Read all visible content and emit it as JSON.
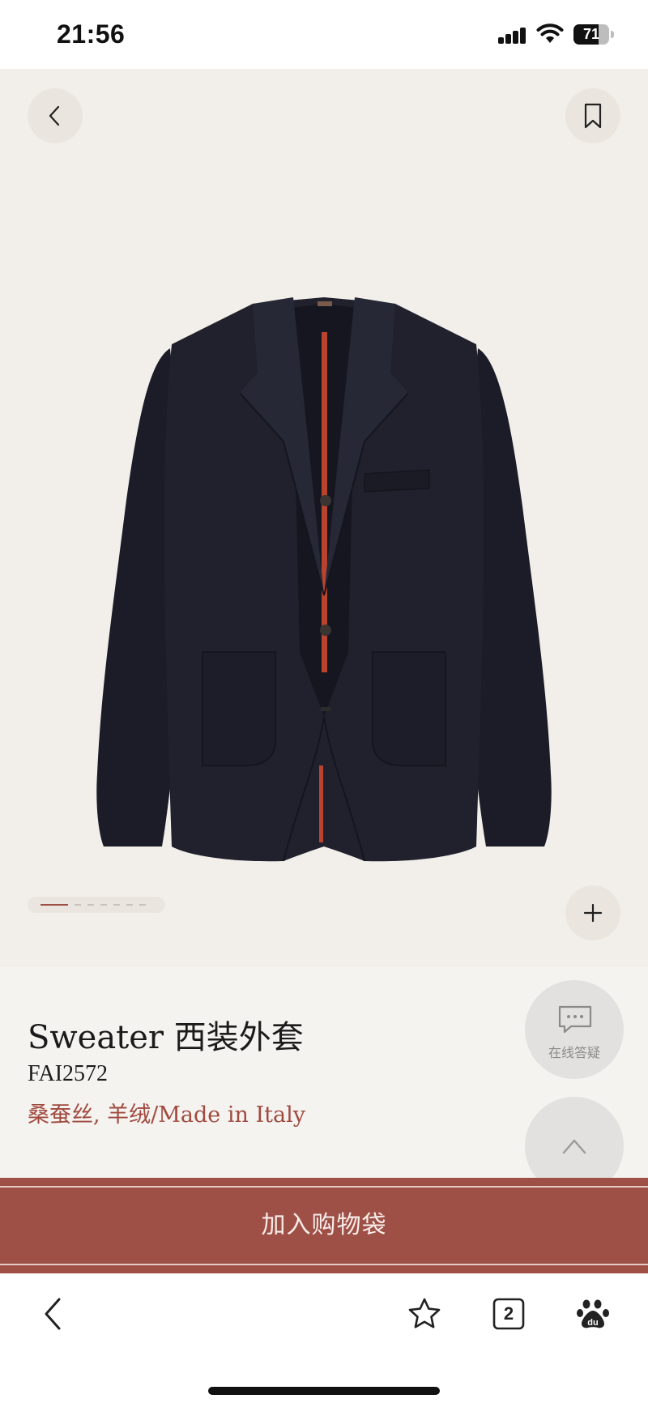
{
  "status_bar": {
    "time": "21:56",
    "battery_level": "71",
    "battery_fraction": 0.71
  },
  "product": {
    "title": "Sweater 西装外套",
    "code": "FAI2572",
    "material": "桑蚕丝, 羊绒/Made in Italy",
    "image_count": 7,
    "active_image_index": 0
  },
  "floating": {
    "chat_label": "在线答疑"
  },
  "cta": {
    "add_to_bag_label": "加入购物袋"
  },
  "browser": {
    "tab_count": "2"
  },
  "colors": {
    "hero_background": "#f2efea",
    "accent": "#9e5047",
    "material_text": "#a04a3f",
    "jacket": "#1e1f2b"
  },
  "icons": {
    "back": "chevron-left-icon",
    "bookmark": "bookmark-icon",
    "zoom": "plus-icon",
    "chat": "chat-bubble-icon",
    "scroll_top": "chevron-up-icon",
    "browser_back": "chevron-left-icon",
    "favorite": "star-icon",
    "tabs": "tabs-icon",
    "baidu": "baidu-paw-icon"
  }
}
